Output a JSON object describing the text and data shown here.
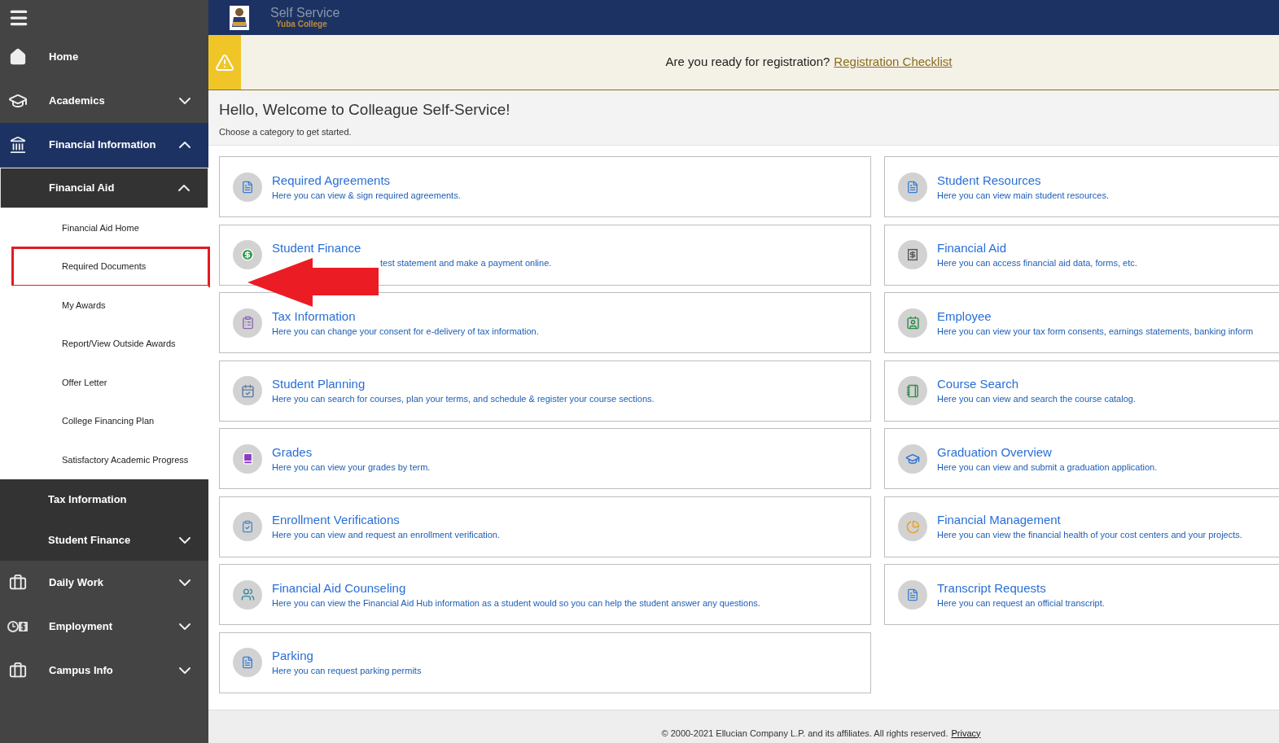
{
  "header": {
    "title": "Self Service",
    "subtitle": "Yuba College"
  },
  "alert": {
    "text": "Are you ready for registration?",
    "link": "Registration Checklist"
  },
  "welcome": {
    "title": "Hello, Welcome to Colleague Self-Service!",
    "subtitle": "Choose a category to get started."
  },
  "sidebar": {
    "items": [
      {
        "label": "Home"
      },
      {
        "label": "Academics",
        "expanded": false
      },
      {
        "label": "Financial Information",
        "expanded": true,
        "children": [
          {
            "label": "Financial Aid",
            "expanded": true,
            "children": [
              {
                "label": "Financial Aid Home",
                "highlighted": false
              },
              {
                "label": "Required Documents",
                "highlighted": true
              },
              {
                "label": "My Awards",
                "highlighted": false
              },
              {
                "label": "Report/View Outside Awards",
                "highlighted": false
              },
              {
                "label": "Offer Letter",
                "highlighted": false
              },
              {
                "label": "College Financing Plan",
                "highlighted": false
              },
              {
                "label": "Satisfactory Academic Progress",
                "highlighted": false
              }
            ]
          },
          {
            "label": "Tax Information"
          },
          {
            "label": "Student Finance",
            "expanded": false
          }
        ]
      },
      {
        "label": "Daily Work",
        "expanded": false
      },
      {
        "label": "Employment",
        "expanded": false
      },
      {
        "label": "Campus Info",
        "expanded": false
      }
    ]
  },
  "cards": {
    "left": [
      {
        "title": "Required Agreements",
        "description": "Here you can view & sign required agreements.",
        "pointed": false
      },
      {
        "title": "Student Finance",
        "description": "test statement and make a payment online.",
        "pointed": true
      },
      {
        "title": "Tax Information",
        "description": "Here you can change your consent for e-delivery of tax information.",
        "pointed": false
      },
      {
        "title": "Student Planning",
        "description": "Here you can search for courses, plan your terms, and schedule & register your course sections.",
        "pointed": false
      },
      {
        "title": "Grades",
        "description": "Here you can view your grades by term.",
        "pointed": false
      },
      {
        "title": "Enrollment Verifications",
        "description": "Here you can view and request an enrollment verification.",
        "pointed": false
      },
      {
        "title": "Financial Aid Counseling",
        "description": "Here you can view the Financial Aid Hub information as a student would so you can help the student answer any questions.",
        "pointed": false
      },
      {
        "title": "Parking",
        "description": "Here you can request parking permits",
        "pointed": false
      }
    ],
    "right": [
      {
        "title": "Student Resources",
        "description": "Here you can view main student resources."
      },
      {
        "title": "Financial Aid",
        "description": "Here you can access financial aid data, forms, etc."
      },
      {
        "title": "Employee",
        "description": "Here you can view your tax form consents, earnings statements, banking inform"
      },
      {
        "title": "Course Search",
        "description": "Here you can view and search the course catalog."
      },
      {
        "title": "Graduation Overview",
        "description": "Here you can view and submit a graduation application."
      },
      {
        "title": "Financial Management",
        "description": "Here you can view the financial health of your cost centers and your projects."
      },
      {
        "title": "Transcript Requests",
        "description": "Here you can request an official transcript."
      }
    ]
  },
  "footer": {
    "text": "© 2000-2021 Ellucian Company L.P. and its affiliates. All rights reserved.",
    "link": "Privacy"
  }
}
